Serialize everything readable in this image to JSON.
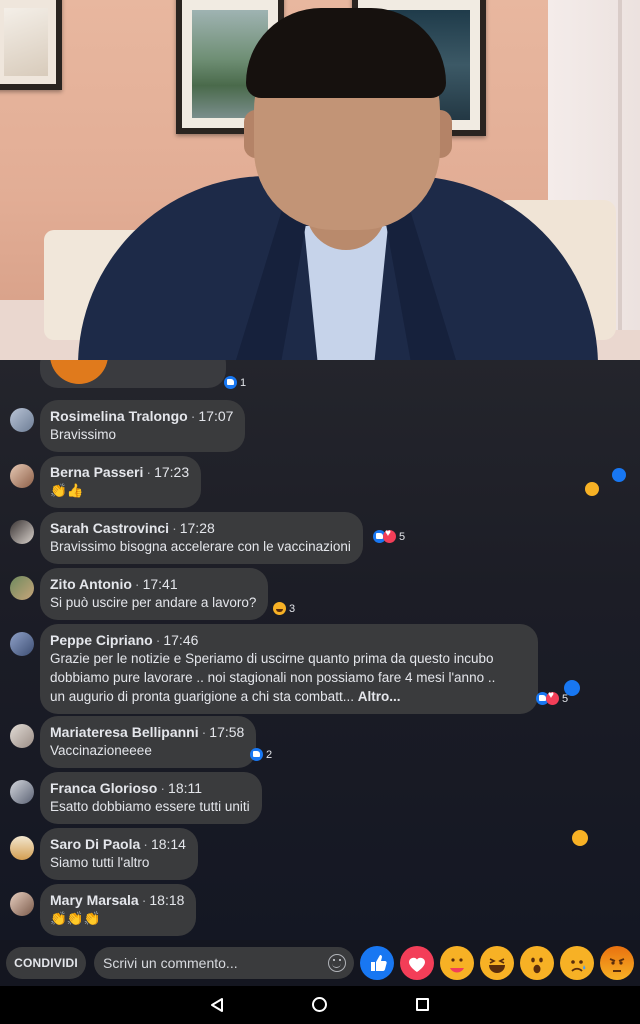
{
  "video": {
    "description_free": true
  },
  "previous_comment": {
    "reaction_count": "1"
  },
  "comments": [
    {
      "name": "Rosimelina Tralongo",
      "time": "17:07",
      "text": "Bravissimo",
      "reactions": ""
    },
    {
      "name": "Berna Passeri",
      "time": "17:23",
      "text": "👏👍",
      "reactions": ""
    },
    {
      "name": "Sarah Castrovinci",
      "time": "17:28",
      "text": "Bravissimo bisogna accelerare con le vaccinazioni",
      "reactions": "5"
    },
    {
      "name": "Zito Antonio",
      "time": "17:41",
      "text": "Si può uscire per andare a lavoro?",
      "reactions": "3"
    },
    {
      "name": "Peppe Cipriano",
      "time": "17:46",
      "lines": [
        "Grazie per le notizie e Speriamo di uscirne quanto prima  da questo incubo",
        "dobbiamo pure lavorare .. noi stagionali non possiamo fare 4 mesi l'anno ..",
        "un augurio di pronta guarigione a chi sta combatt..."
      ],
      "more": "Altro...",
      "reactions": "5"
    },
    {
      "name": "Mariateresa Bellipanni",
      "time": "17:58",
      "text": "Vaccinazioneeee",
      "reactions": "2"
    },
    {
      "name": "Franca Glorioso",
      "time": "18:11",
      "text": "Esatto dobbiamo essere tutti uniti",
      "reactions": ""
    },
    {
      "name": "Saro Di Paola",
      "time": "18:14",
      "text": "Siamo tutti l'altro",
      "reactions": ""
    },
    {
      "name": "Mary Marsala",
      "time": "18:18",
      "text": "👏👏👏",
      "reactions": ""
    }
  ],
  "bottom_bar": {
    "share_label": "CONDIVIDI",
    "comment_placeholder": "Scrivi un commento...",
    "reactions": [
      "like-icon",
      "love-icon",
      "care-icon",
      "haha-icon",
      "wow-icon",
      "sad-icon",
      "angry-icon"
    ]
  },
  "navbar": {
    "buttons": [
      "back-icon",
      "home-icon",
      "recents-icon"
    ]
  },
  "colors": {
    "bubble": "#3a3b3d",
    "like": "#1877f2",
    "love": "#f33e58",
    "haha": "#f7b125"
  }
}
